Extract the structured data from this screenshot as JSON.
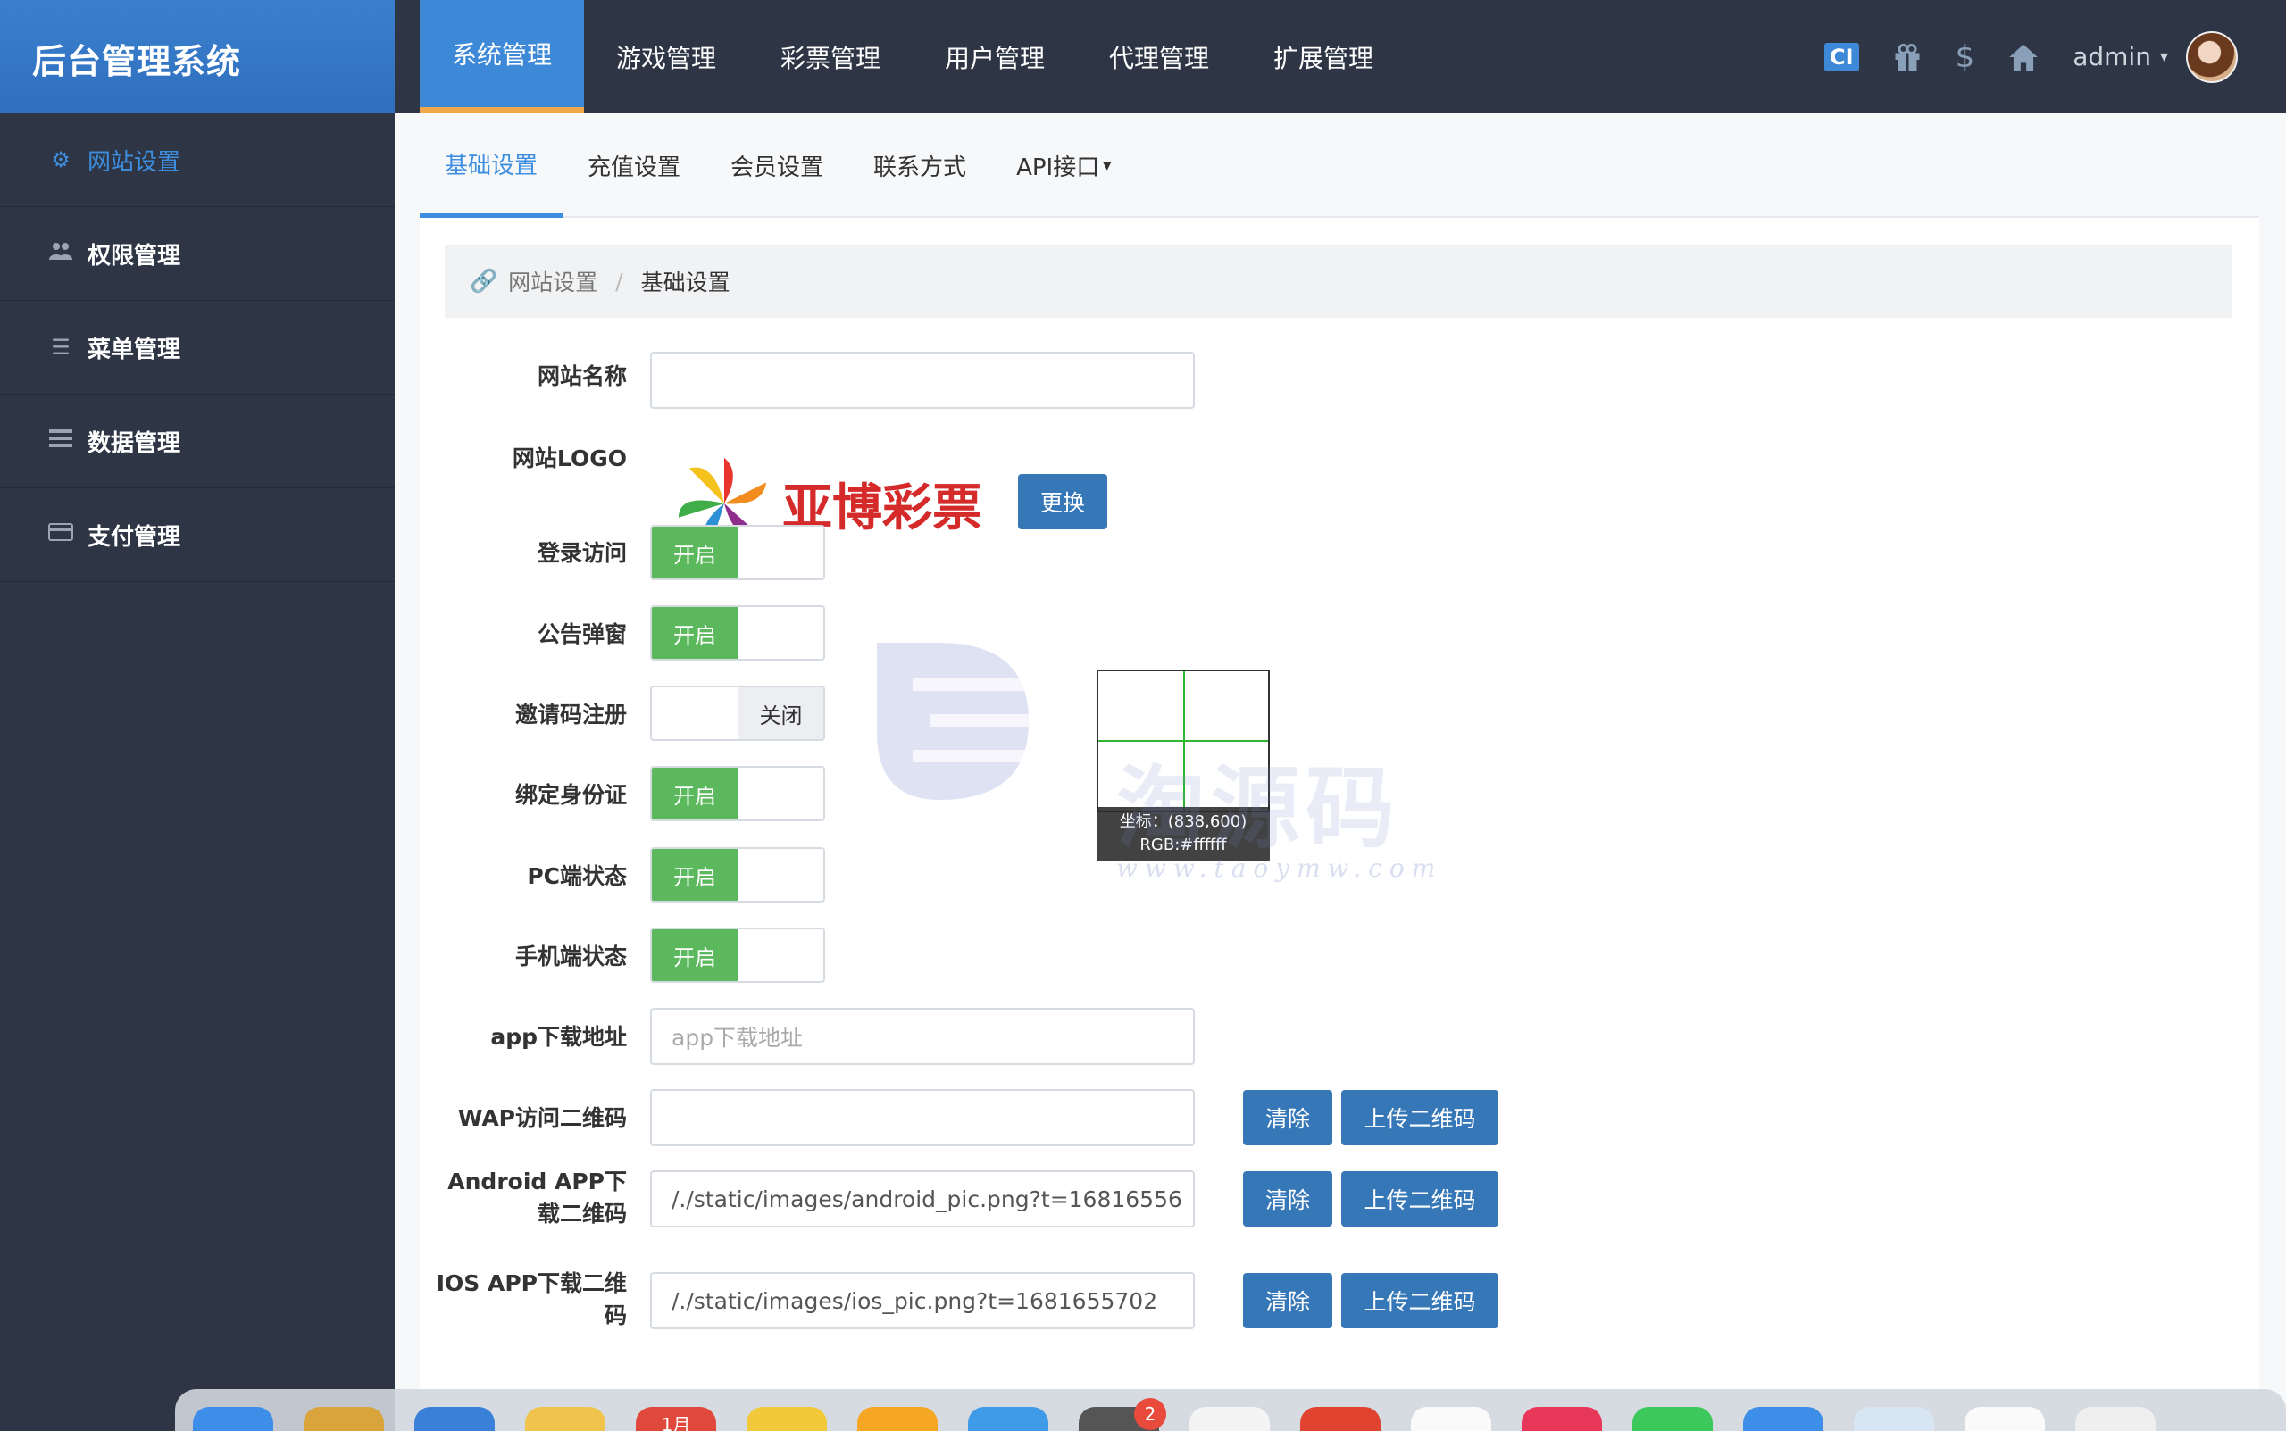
{
  "app_title": "后台管理系统",
  "top_nav": [
    "系统管理",
    "游戏管理",
    "彩票管理",
    "用户管理",
    "代理管理",
    "扩展管理"
  ],
  "top_right": {
    "icon_ci": "CI",
    "admin_label": "admin"
  },
  "sidebar": [
    {
      "label": "网站设置",
      "icon": "gear-icon"
    },
    {
      "label": "权限管理",
      "icon": "users-icon"
    },
    {
      "label": "菜单管理",
      "icon": "list-icon"
    },
    {
      "label": "数据管理",
      "icon": "data-icon"
    },
    {
      "label": "支付管理",
      "icon": "card-icon"
    }
  ],
  "tabs": [
    "基础设置",
    "充值设置",
    "会员设置",
    "联系方式",
    "API接口"
  ],
  "breadcrumb": {
    "parent": "网站设置",
    "sep": "/",
    "current": "基础设置"
  },
  "form": {
    "site_name_label": "网站名称",
    "site_name_value": "",
    "logo_label": "网站LOGO",
    "logo_text": "亚博彩票",
    "replace_button": "更换",
    "login_access_label": "登录访问",
    "notice_popup_label": "公告弹窗",
    "invite_reg_label": "邀请码注册",
    "bind_id_label": "绑定身份证",
    "pc_status_label": "PC端状态",
    "mobile_status_label": "手机端状态",
    "on_text": "开启",
    "off_text": "关闭",
    "app_download_label": "app下载地址",
    "app_download_placeholder": "app下载地址",
    "wap_qr_label": "WAP访问二维码",
    "wap_qr_value": "",
    "android_qr_label": "Android APP下载二维码",
    "android_qr_value": "/./static/images/android_pic.png?t=16816556",
    "ios_qr_label": "IOS APP下载二维码",
    "ios_qr_value": "/./static/images/ios_pic.png?t=1681655702",
    "clear_button": "清除",
    "upload_button": "上传二维码"
  },
  "picker_tooltip": {
    "coord": "坐标：(838,600)",
    "rgb": "RGB:#ffffff"
  },
  "watermark": {
    "text": "淘源码",
    "url": "www.taoymw.com"
  },
  "dock": {
    "calendar_label": "1月",
    "badge_count": "2"
  }
}
